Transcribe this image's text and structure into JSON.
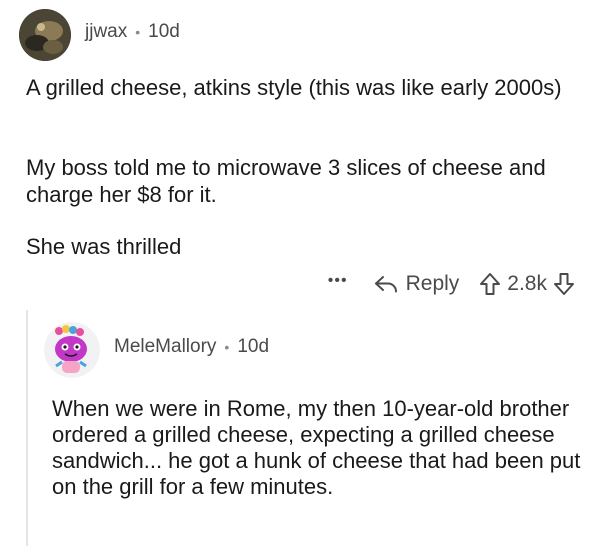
{
  "comment": {
    "author": "jjwax",
    "age": "10d",
    "paragraphs": [
      "A grilled cheese, atkins style (this was like early 2000s)",
      "My boss told me to microwave 3 slices of cheese and charge her $8 for it.",
      "She was thrilled"
    ],
    "actions": {
      "more": "•••",
      "reply_label": "Reply",
      "score": "2.8k"
    }
  },
  "reply": {
    "author": "MeleMallory",
    "age": "10d",
    "text": "When we were in Rome, my then 10-year-old brother ordered a grilled cheese, expecting a grilled cheese sandwich... he got a hunk of cheese that had been put on the grill for a few minutes."
  },
  "separator": "•"
}
